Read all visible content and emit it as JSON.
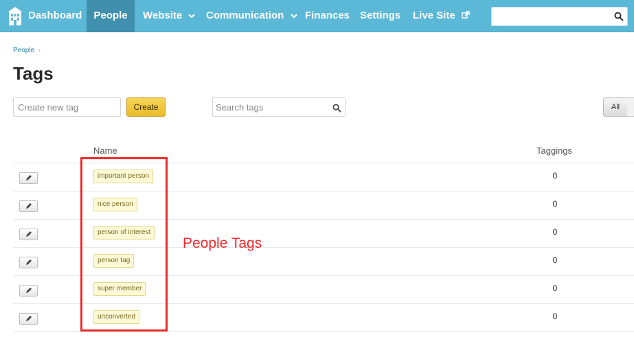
{
  "nav": {
    "items": [
      {
        "label": "Dashboard"
      },
      {
        "label": "People"
      },
      {
        "label": "Website"
      },
      {
        "label": "Communication"
      },
      {
        "label": "Finances"
      },
      {
        "label": "Settings"
      },
      {
        "label": "Live Site"
      }
    ],
    "active": "People",
    "search_value": ""
  },
  "breadcrumb": {
    "items": [
      "People"
    ]
  },
  "page": {
    "title": "Tags"
  },
  "controls": {
    "new_tag_placeholder": "Create new tag",
    "create_label": "Create",
    "search_placeholder": "Search tags",
    "filter_all_label": "All"
  },
  "table": {
    "headers": {
      "name": "Name",
      "taggings": "Taggings"
    },
    "rows": [
      {
        "name": "important person",
        "taggings": "0"
      },
      {
        "name": "nice person",
        "taggings": "0"
      },
      {
        "name": "person of interest",
        "taggings": "0"
      },
      {
        "name": "person tag",
        "taggings": "0"
      },
      {
        "name": "super member",
        "taggings": "0"
      },
      {
        "name": "unconverted",
        "taggings": "0"
      }
    ]
  },
  "annotation": {
    "text": "People Tags",
    "color": "#ee2b2b"
  },
  "colors": {
    "nav_bg": "#5bb8d6",
    "nav_active": "#3f8fad",
    "create_button": "#e9bb2a",
    "tag_bg": "#fdf9d6"
  },
  "icons": [
    "building-logo-icon",
    "chevron-down-icon",
    "external-link-icon",
    "search-icon",
    "pencil-icon",
    "chevron-right-icon"
  ]
}
